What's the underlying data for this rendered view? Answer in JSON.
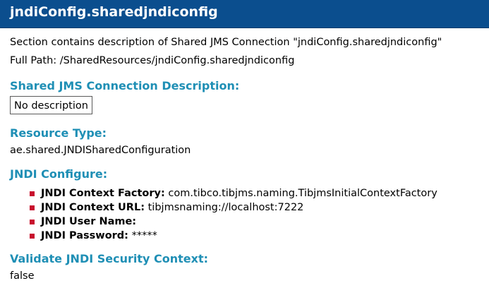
{
  "header": {
    "title": "jndiConfig.sharedjndiconfig"
  },
  "intro": {
    "section_description": "Section contains description of Shared JMS Connection \"jndiConfig.sharedjndiconfig\"",
    "full_path": "Full Path: /SharedResources/jndiConfig.sharedjndiconfig"
  },
  "connection_description": {
    "heading": "Shared JMS Connection Description:",
    "value": "No description"
  },
  "resource_type": {
    "heading": "Resource Type:",
    "value": "ae.shared.JNDISharedConfiguration"
  },
  "jndi_configure": {
    "heading": "JNDI Configure:",
    "items": [
      {
        "label": "JNDI Context Factory:",
        "value": " com.tibco.tibjms.naming.TibjmsInitialContextFactory"
      },
      {
        "label": "JNDI Context URL:",
        "value": " tibjmsnaming://localhost:7222"
      },
      {
        "label": "JNDI User Name:",
        "value": ""
      },
      {
        "label": "JNDI Password:",
        "value": " *****"
      }
    ]
  },
  "validate_security": {
    "heading": "Validate JNDI Security Context:",
    "value": "false"
  },
  "colors": {
    "title_bar": "#0b4e8e",
    "heading_text": "#1f8fb5",
    "bullet": "#c8102e"
  }
}
